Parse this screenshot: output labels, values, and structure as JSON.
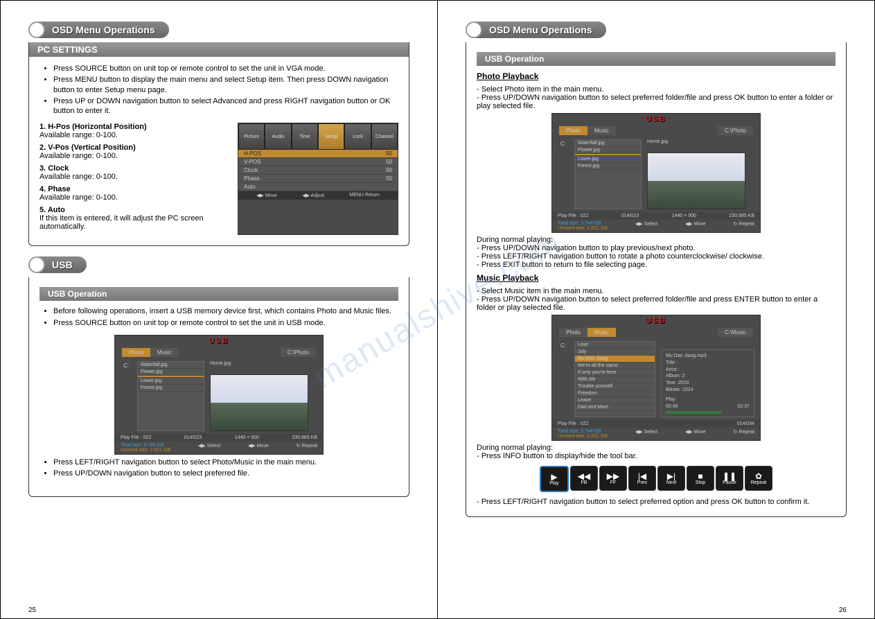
{
  "left": {
    "header1": "OSD Menu Operations",
    "pcSettings": {
      "title": "PC SETTINGS",
      "bullets": [
        "Press SOURCE button on unit top or remote control to set the unit in VGA mode.",
        "Press MENU button to display the main menu and select Setup item. Then press DOWN navigation button to enter Setup menu page.",
        "Press UP or DOWN navigation button to select Advanced and press RIGHT navigation button or OK button to enter it."
      ],
      "items": [
        {
          "t": "1. H-Pos (Horizontal Position)",
          "d": "Available range: 0-100."
        },
        {
          "t": "2. V-Pos (Vertical Position)",
          "d": "Available range: 0-100."
        },
        {
          "t": "3. Clock",
          "d": "Available range: 0-100."
        },
        {
          "t": "4. Phase",
          "d": "Available range: 0-100."
        },
        {
          "t": "5. Auto",
          "d": "If this item is entered, it will adjust the PC screen automatically."
        }
      ],
      "osd": {
        "tabs": [
          "Picture",
          "Audio",
          "Time",
          "Setup",
          "Lock",
          "Channel"
        ],
        "rows": [
          {
            "l": "H-POS",
            "v": "50",
            "sel": true
          },
          {
            "l": "V-POS",
            "v": "50"
          },
          {
            "l": "Clock",
            "v": "50"
          },
          {
            "l": "Phase",
            "v": "50"
          },
          {
            "l": "Auto",
            "v": ""
          }
        ],
        "footer": [
          "◀▶ Move",
          "◀▶ Adjust",
          "MENU Return"
        ]
      }
    },
    "usb": {
      "header": "USB",
      "sub": "USB Operation",
      "bullets": [
        "Before following operations, insert a USB memory device first, which contains Photo and Music files.",
        "Press SOURCE button on unit top or remote control to set the unit in USB mode."
      ],
      "screen": {
        "title": "USB",
        "tabs": [
          "Photo",
          "Music"
        ],
        "path": "C:\\Photo",
        "drive": "C:",
        "files": [
          "Waterfall.jpg",
          "Flower.jpg",
          "",
          "Lower.jpg",
          "Forest.jpg"
        ],
        "preview": "Home.jpg",
        "playInfo": {
          "label": "Play File : 022",
          "count": "014/023"
        },
        "res": "1440 × 900",
        "size": "230.985 KB",
        "total": "Total size: 3.748 GB",
        "unused": "Unused size: 2.821 GB",
        "controls": [
          "◀▶ Select",
          "◀▶ Move",
          "↻ Repeat"
        ]
      },
      "bullets2": [
        "Press LEFT/RIGHT navigation button to select Photo/Music in the main menu.",
        "Press UP/DOWN navigation button to select preferred file."
      ]
    },
    "pageNum": "25"
  },
  "right": {
    "header": "OSD Menu Operations",
    "sub": "USB Operation",
    "photo": {
      "title": "Photo Playback",
      "intro": [
        "- Select Photo item in the main menu.",
        "- Press UP/DOWN navigation button to select preferred folder/file and press OK button to enter a folder or play selected file."
      ],
      "during": "During normal playing:",
      "notes": [
        "- Press UP/DOWN navigation button to play previous/next photo.",
        "- Press LEFT/RIGHT navigation button to rotate a photo counterclockwise/ clockwise.",
        "- Press EXIT button to return to file selecting page."
      ]
    },
    "music": {
      "title": "Music Playback",
      "intro": [
        "- Select Music item in the main menu.",
        "- Press UP/DOWN navigation button to select preferred folder/file and press ENTER button to enter a folder or play selected file."
      ],
      "screen": {
        "title": "USB",
        "tabs": [
          "Photo",
          "Music"
        ],
        "path": "C:\\Music",
        "drive": "C:",
        "files": [
          "Love",
          "July",
          "Mu Dan Jiang",
          "We're all the same",
          "If only you're here",
          "With Me",
          "Trouble yourself",
          "Freedom",
          "Leave",
          "Dad and Mom"
        ],
        "track": "Mu Dan Jiang.mp3",
        "info": {
          "Title": "",
          "Artist": "",
          "Album": "2",
          "Year": "2010",
          "Bitrate": "1024"
        },
        "play": {
          "label": "Play",
          "cur": "00:45",
          "tot": "02:37"
        },
        "playInfo": {
          "label": "Play File : 022",
          "count": "014/034"
        },
        "total": "Total size: 3.748 GB",
        "unused": "Unused size: 2.821 GB",
        "controls": [
          "◀▶ Select",
          "◀▶ Move",
          "↻ Repeat"
        ]
      },
      "during": "During normal playing:",
      "note1": "- Press INFO button to display/hide the tool bar.",
      "toolbar": [
        {
          "i": "▶",
          "l": "Play"
        },
        {
          "i": "◀◀",
          "l": "FB"
        },
        {
          "i": "▶▶",
          "l": "FF"
        },
        {
          "i": "|◀",
          "l": "Prev"
        },
        {
          "i": "▶|",
          "l": "Next"
        },
        {
          "i": "■",
          "l": "Stop"
        },
        {
          "i": "❚❚",
          "l": "Pause"
        },
        {
          "i": "✿",
          "l": "Repeat"
        }
      ],
      "note2": "- Press LEFT/RIGHT navigation button to select preferred option and press OK button to confirm it."
    },
    "pageNum": "26"
  },
  "watermark": "manualshive.com"
}
